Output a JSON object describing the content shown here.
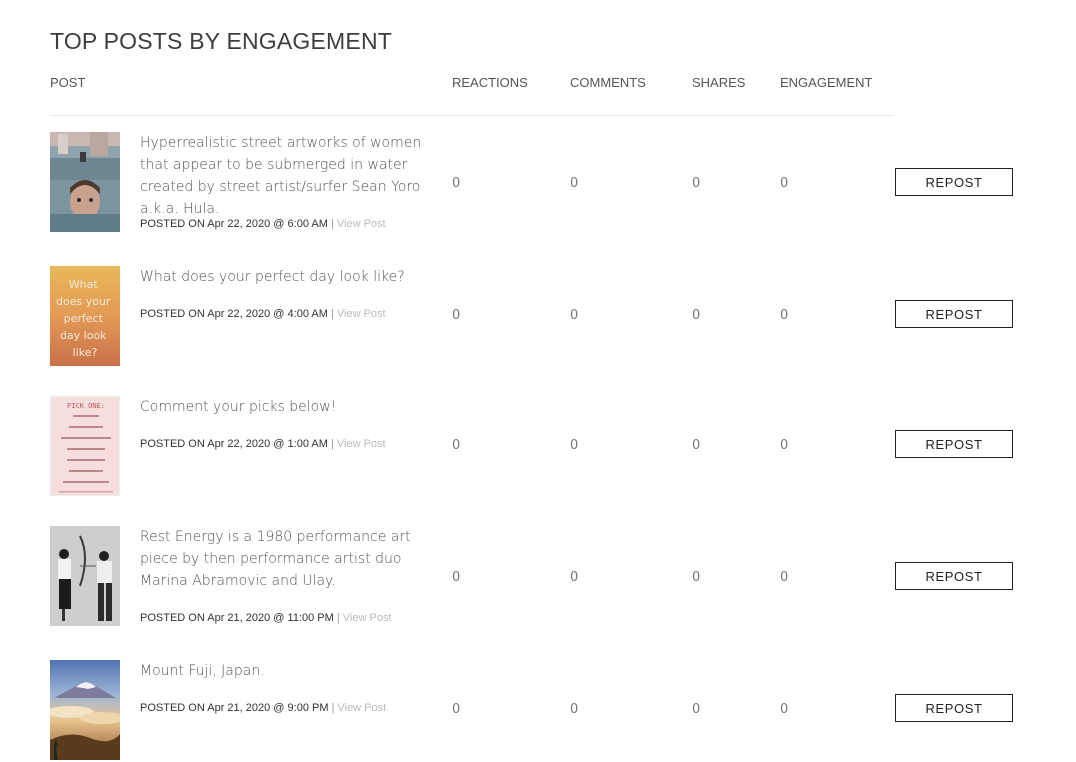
{
  "title": "TOP POSTS BY ENGAGEMENT",
  "columns": {
    "post": "POST",
    "reactions": "REACTIONS",
    "comments": "COMMENTS",
    "shares": "SHARES",
    "engagement": "ENGAGEMENT"
  },
  "posts": [
    {
      "text": "Hyperrealistic street artworks of women that appear to be submerged in water created by street artist/surfer Sean Yoro a.k.a. Hula.",
      "posted_prefix": "POSTED ON",
      "date": "Apr 22, 2020 @ 6:00 AM",
      "separator": "|",
      "view_link": "View Post",
      "reactions": "0",
      "comments": "0",
      "shares": "0",
      "engagement": "0",
      "button": "REPOST",
      "thumbnail": "submerged-portrait-mural"
    },
    {
      "text": "What does your perfect day look like?",
      "posted_prefix": "POSTED ON",
      "date": "Apr 22, 2020 @ 4:00 AM",
      "separator": "|",
      "view_link": "View Post",
      "reactions": "0",
      "comments": "0",
      "shares": "0",
      "engagement": "0",
      "button": "REPOST",
      "thumbnail": "perfect-day-quote-card",
      "thumbnail_text": "What does your perfect day look like?"
    },
    {
      "text": "Comment your picks below!",
      "posted_prefix": "POSTED ON",
      "date": "Apr 22, 2020 @ 1:00 AM",
      "separator": "|",
      "view_link": "View Post",
      "reactions": "0",
      "comments": "0",
      "shares": "0",
      "engagement": "0",
      "button": "REPOST",
      "thumbnail": "pick-one-list-card",
      "thumbnail_text": "PICK ONE:"
    },
    {
      "text": "Rest Energy is a 1980 performance art piece by then performance artist duo Marina Abramovic and Ulay.",
      "posted_prefix": "POSTED ON",
      "date": "Apr 21, 2020 @ 11:00 PM",
      "separator": "|",
      "view_link": "View Post",
      "reactions": "0",
      "comments": "0",
      "shares": "0",
      "engagement": "0",
      "button": "REPOST",
      "thumbnail": "rest-energy-photo"
    },
    {
      "text": "Mount Fuji, Japan.",
      "posted_prefix": "POSTED ON",
      "date": "Apr 21, 2020 @ 9:00 PM",
      "separator": "|",
      "view_link": "View Post",
      "reactions": "0",
      "comments": "0",
      "shares": "0",
      "engagement": "0",
      "button": "REPOST",
      "thumbnail": "mount-fuji-photo"
    }
  ]
}
